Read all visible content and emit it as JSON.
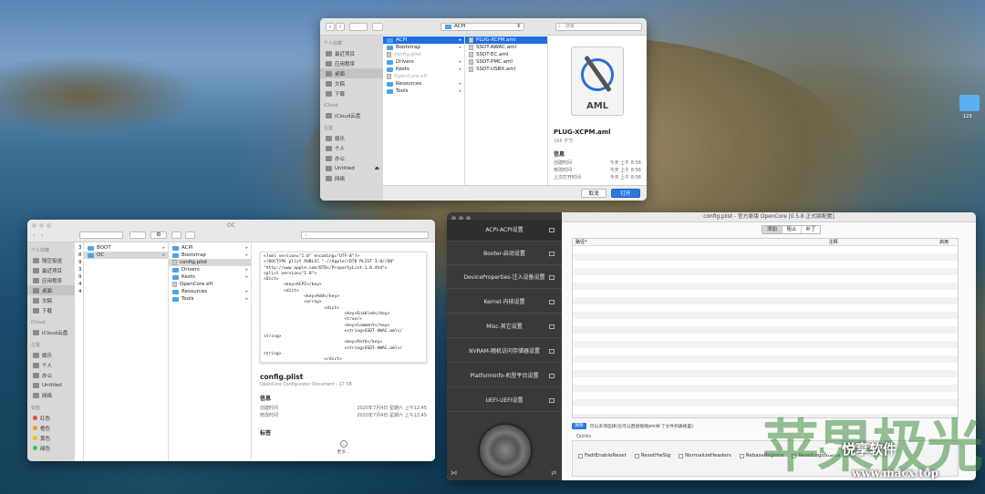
{
  "desktop": {
    "icon_label": "123"
  },
  "watermark": {
    "brand": "悦享软件",
    "big_text": "苹果极光",
    "url": "www.macx.top"
  },
  "dialog": {
    "location": "ACPI",
    "search_placeholder": "搜索",
    "sidebar": {
      "favorites_header": "个人收藏",
      "favorites": [
        "最近项目",
        "应用程序",
        "桌面",
        "文稿",
        "下载"
      ],
      "icloud_header": "iCloud",
      "icloud": [
        "iCloud云盘"
      ],
      "locations_header": "位置",
      "locations": [
        "娱乐",
        "个人",
        "办公",
        "Untitled",
        "网络"
      ]
    },
    "col1": [
      "ACPI",
      "Bootstrap",
      "config.plist",
      "Drivers",
      "Kexts",
      "OpenCore.efi",
      "Resources",
      "Tools"
    ],
    "col2": [
      "PLUG-XCPM.aml",
      "SSDT-AWAC.aml",
      "SSDT-EC.aml",
      "SSDT-PMC.aml",
      "SSDT-USBX.aml"
    ],
    "preview": {
      "badge": "AML",
      "name": "PLUG-XCPM.aml",
      "size": "166 字节",
      "info": "信息",
      "rows": [
        {
          "k": "创建时间",
          "v": "今天 上午 8:56"
        },
        {
          "k": "修改时间",
          "v": "今天 上午 8:56"
        },
        {
          "k": "上次打开时间",
          "v": "今天 上午 8:56"
        }
      ]
    },
    "cancel": "取消",
    "open": "打开"
  },
  "finder": {
    "title": "OC",
    "sidebar": {
      "favorites_header": "个人收藏",
      "favorites": [
        "隔空投送",
        "最近项目",
        "应用程序",
        "桌面",
        "文稿",
        "下载"
      ],
      "icloud_header": "iCloud",
      "icloud": [
        "iCloud云盘"
      ],
      "locations_header": "位置",
      "locations": [
        "娱乐",
        "个人",
        "办公",
        "Untitled",
        "网络"
      ],
      "tags_header": "标签",
      "tags": [
        {
          "name": "红色",
          "color": "#e84c3d"
        },
        {
          "name": "橙色",
          "color": "#f39c12"
        },
        {
          "name": "黄色",
          "color": "#f1c40f"
        },
        {
          "name": "绿色",
          "color": "#2ecc71"
        }
      ]
    },
    "col0_nums": [
      "3",
      "8",
      "9",
      "3",
      "9",
      "4",
      "4"
    ],
    "col1": [
      "BOOT",
      "OC"
    ],
    "col2": [
      "ACPI",
      "Bootstrap",
      "config.plist",
      "Drivers",
      "Kexts",
      "OpenCore.efi",
      "Resources",
      "Tools"
    ],
    "code": "<?xml version=\"1.0\" encoding=\"UTF-8\"?>\n<!DOCTYPE plist PUBLIC \"-//Apple//DTD PLIST 1.0//EN\"\n\"http://www.apple.com/DTDs/PropertyList-1.0.dtd\">\n<plist version=\"1.0\">\n<dict>\n        <key>ACPI</key>\n        <dict>\n                <key>Add</key>\n                <array>\n                        <dict>\n                                <key>Enabled</key>\n                                <true/>\n                                <key>Comment</key>\n                                <string>SSDT-AWAC.aml</\nstring>\n                                <key>Path</key>\n                                <string>SSDT-AWAC.aml</\nstring>\n                        </dict>\n                        <dict>",
    "file": {
      "name": "config.plist",
      "desc": "OpenCore Configurator Document - 17 KB",
      "info": "信息",
      "rows": [
        {
          "k": "创建时间",
          "v": "2020年7月4日 星期六 上午12:45"
        },
        {
          "k": "修改时间",
          "v": "2020年7月4日 星期六 上午12:45"
        }
      ],
      "tags": "标签",
      "more": "更多..."
    }
  },
  "oc": {
    "title": "config.plist - 官方原版 OpenCore [0.5.8 正式版配置]",
    "menu": [
      "ACPI-ACPI设置",
      "Booter-启动设置",
      "DeviceProperties-注入设备设置",
      "Kernel-内核设置",
      "Misc-其它设置",
      "NVRAM-随机访问存储器设置",
      "PlatformInfo-机型平台设置",
      "UEFI-UEFI设置"
    ],
    "tabs": [
      "添加",
      "阻止",
      "补丁"
    ],
    "columns": [
      "路径*",
      "注释",
      "启用"
    ],
    "note": "可以多项选择(也可以直接拖拽aml补丁文件到表格里)",
    "note_btn": "清除",
    "quirks_label": "Quirks",
    "quirks": [
      "FadtEnableReset",
      "ResetHwSig",
      "NormalizeHeaders",
      "RebaseRegions",
      "ResetLogoStatus"
    ]
  }
}
